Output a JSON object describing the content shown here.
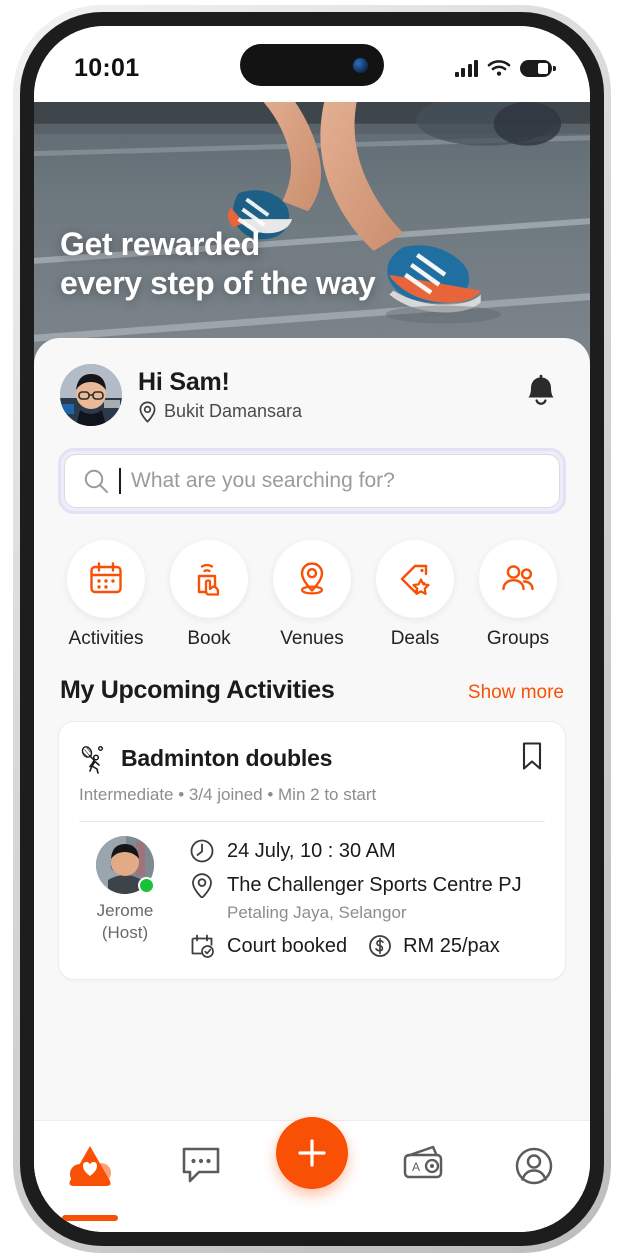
{
  "colors": {
    "accent": "#f85005",
    "sheet_bg": "#f8f8f8",
    "text_dark": "#1b1b1b",
    "muted": "#8d8d8d",
    "online": "#18c135"
  },
  "status_bar": {
    "time": "10:01",
    "signal_icon": "cellular-signal-icon",
    "wifi_icon": "wifi-icon",
    "battery_icon": "battery-icon"
  },
  "hero": {
    "headline_line1": "Get rewarded",
    "headline_line2": "every step of the way",
    "dots_total": 4,
    "active_dot": 1,
    "image_alt": "runner-on-road"
  },
  "profile": {
    "greeting": "Hi Sam!",
    "location": "Bukit Damansara",
    "location_icon": "location-pin-icon",
    "avatar": "user-avatar",
    "bell_icon": "notification-bell-icon"
  },
  "search": {
    "placeholder": "What are you searching for?",
    "value": "",
    "icon": "search-icon"
  },
  "categories": [
    {
      "label": "Activities",
      "icon": "calendar-icon"
    },
    {
      "label": "Book",
      "icon": "tap-booking-icon"
    },
    {
      "label": "Venues",
      "icon": "map-pin-icon"
    },
    {
      "label": "Deals",
      "icon": "tag-star-icon"
    },
    {
      "label": "Groups",
      "icon": "people-group-icon"
    }
  ],
  "section": {
    "title": "My Upcoming Activities",
    "show_more": "Show more"
  },
  "activity_card": {
    "sport_icon": "badminton-player-icon",
    "title": "Badminton doubles",
    "bookmark_icon": "bookmark-icon",
    "meta": "Intermediate • 3/4 joined • Min 2 to start",
    "host": {
      "name": "Jerome",
      "role": "(Host)",
      "avatar": "host-avatar",
      "status": "online"
    },
    "datetime": "24 July, 10 : 30 AM",
    "datetime_icon": "clock-icon",
    "venue": "The Challenger Sports Centre PJ",
    "venue_icon": "location-pin-icon",
    "venue_sub": "Petaling Jaya, Selangor",
    "booking_status": "Court booked",
    "booking_icon": "calendar-check-icon",
    "price": "RM 25/pax",
    "price_icon": "dollar-circle-icon"
  },
  "bottom_nav": [
    {
      "label": "home",
      "icon": "home-logo-icon",
      "active": true
    },
    {
      "label": "chat",
      "icon": "chat-bubble-icon",
      "active": false
    },
    {
      "label": "create",
      "icon": "plus-icon",
      "active": false
    },
    {
      "label": "wallet",
      "icon": "wallet-icon",
      "active": false
    },
    {
      "label": "profile",
      "icon": "profile-circle-icon",
      "active": false
    }
  ]
}
